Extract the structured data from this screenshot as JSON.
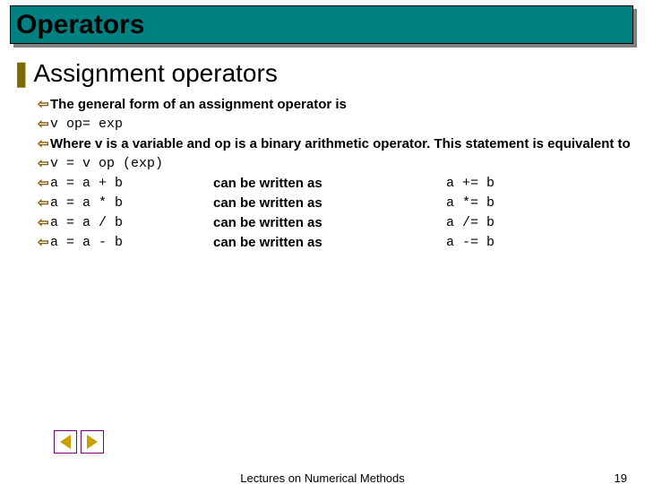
{
  "title": "Operators",
  "heading": "Assignment operators",
  "lines": {
    "intro": "The general form of an assignment operator is",
    "form": "v op= exp",
    "where": "Where v is a variable and op is a binary arithmetic operator. This statement is equivalent to",
    "expand": "v = v op (exp)"
  },
  "rows": [
    {
      "lhs": "a = a + b",
      "mid": "can be written as",
      "rhs": "a += b"
    },
    {
      "lhs": "a = a * b",
      "mid": "can be written as",
      "rhs": "a *= b"
    },
    {
      "lhs": "a = a / b",
      "mid": "can be written as",
      "rhs": "a /= b"
    },
    {
      "lhs": "a = a - b",
      "mid": "can be written as",
      "rhs": "a -= b"
    }
  ],
  "footer": {
    "center": "Lectures on Numerical Methods",
    "page": "19"
  }
}
